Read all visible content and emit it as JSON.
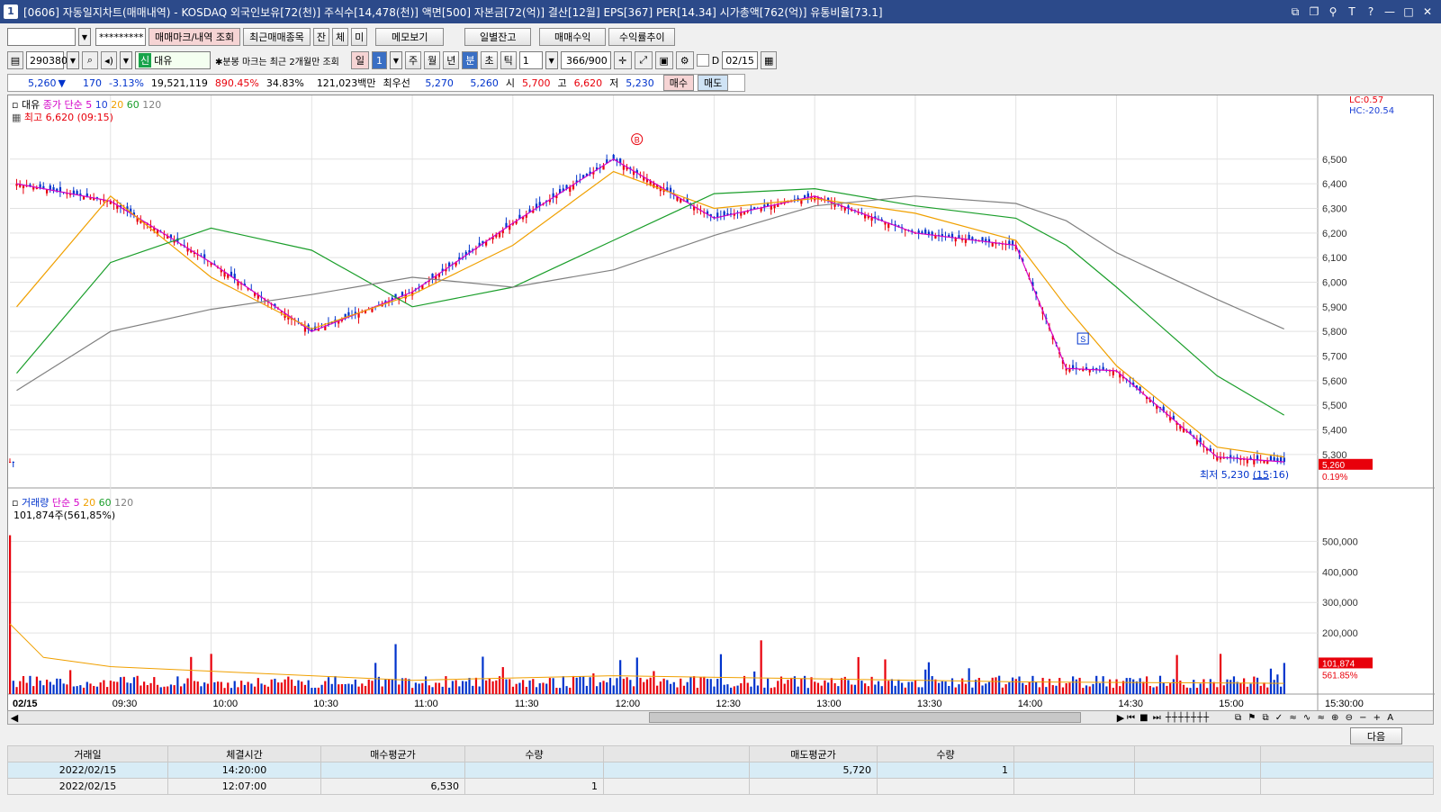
{
  "window": {
    "number": "1",
    "title": "[0606] 자동일지차트(매매내역) - KOSDAQ 외국인보유[72(천)] 주식수[14,478(천)] 액면[500] 자본금[72(억)] 결산[12월] EPS[367] PER[14.34] 시가총액[762(억)] 유통비율[73.1]"
  },
  "toolbar1": {
    "account_value": "",
    "password_mask": "*********",
    "btn_marks": "매매마크/내역 조회",
    "btn_recent": "최근매매종목",
    "btn_jan": "잔",
    "btn_che": "체",
    "btn_mi": "미",
    "btn_memo": "메모보기",
    "btn_daily": "일별잔고",
    "btn_profit": "매매수익",
    "btn_trend": "수익률추이"
  },
  "toolbar2": {
    "code": "290380",
    "badge": "신",
    "name": "대유",
    "note": "✱분봉 마크는 최근 2개월만 조회",
    "period_il": "일",
    "period_num": "1",
    "ju": "주",
    "wol": "월",
    "nyeon": "년",
    "bun": "분",
    "cho": "초",
    "tik": "틱",
    "interval": "1",
    "count": "366/900",
    "d_label": "D",
    "date": "02/15"
  },
  "quote": {
    "price": "5,260",
    "arrow": "▼",
    "change": "170",
    "pct": "-3.13%",
    "volume": "19,521,119",
    "vol_ratio": "890.45%",
    "turnover": "34.83%",
    "amount": "121,023백만",
    "best_label": "최우선",
    "best_ask": "5,270",
    "best_bid": "5,260",
    "open_label": "시",
    "open": "5,700",
    "high_label": "고",
    "high": "6,620",
    "low_label": "저",
    "low": "5,230",
    "buy": "매수",
    "sell": "매도"
  },
  "price_panel": {
    "name": "대유",
    "legend_prefix": "종가 단순",
    "ma_periods": [
      "5",
      "10",
      "20",
      "60",
      "120"
    ],
    "high_note": "최고 6,620 (09:15)",
    "low_note": "최저 5,230 (15:16)",
    "lc": "LC:0.57",
    "hc": "HC:-20.54",
    "current_tag": "5,260",
    "current_pct": "0.19%",
    "y_ticks": [
      "6,500",
      "6,400",
      "6,300",
      "6,200",
      "6,100",
      "6,000",
      "5,900",
      "5,800",
      "5,700",
      "5,600",
      "5,500",
      "5,400",
      "5,300"
    ],
    "marker_buy": "B",
    "marker_sell": "S"
  },
  "volume_panel": {
    "name": "거래량",
    "legend_prefix": "단순",
    "ma_periods": [
      "5",
      "20",
      "60",
      "120"
    ],
    "note": "101,874주(561,85%)",
    "y_ticks": [
      "500,000",
      "400,000",
      "300,000",
      "200,000"
    ],
    "current_tag": "101,874",
    "current_pct": "561.85%"
  },
  "x_axis": {
    "labels": [
      "02/15",
      "09:30",
      "10:00",
      "10:30",
      "11:00",
      "11:30",
      "12:00",
      "12:30",
      "13:00",
      "13:30",
      "14:00",
      "14:30",
      "15:00",
      "15:30:00"
    ]
  },
  "colors": {
    "up": "#e8000b",
    "down": "#0033cc",
    "ma5": "#d400c8",
    "ma10": "#1a3fd6",
    "ma20": "#f0a000",
    "ma60": "#1a9e2a",
    "ma120": "#808080"
  },
  "chart_data": {
    "type": "candlestick",
    "title": "대유",
    "xlabel": "",
    "ylabel": "",
    "ylim": [
      5200,
      6620
    ],
    "ma_series": [
      {
        "name": "5",
        "x": [
          "09:02",
          "09:30",
          "10:00",
          "10:30",
          "11:00",
          "11:30",
          "12:00",
          "12:30",
          "13:00",
          "13:30",
          "14:00",
          "14:15",
          "14:30",
          "15:00",
          "15:20"
        ],
        "values": [
          6400,
          6330,
          6080,
          5800,
          5960,
          6240,
          6500,
          6260,
          6350,
          6200,
          6150,
          5650,
          5640,
          5290,
          5270
        ]
      },
      {
        "name": "20",
        "x": [
          "09:02",
          "09:30",
          "10:00",
          "10:30",
          "11:00",
          "11:30",
          "12:00",
          "12:30",
          "13:00",
          "13:30",
          "14:00",
          "14:15",
          "14:30",
          "15:00",
          "15:20"
        ],
        "values": [
          5900,
          6350,
          6020,
          5810,
          5950,
          6150,
          6450,
          6300,
          6340,
          6280,
          6170,
          5900,
          5660,
          5330,
          5290
        ]
      },
      {
        "name": "60",
        "x": [
          "09:02",
          "09:30",
          "10:00",
          "10:30",
          "11:00",
          "11:30",
          "12:00",
          "12:30",
          "13:00",
          "13:30",
          "14:00",
          "14:15",
          "14:30",
          "15:00",
          "15:20"
        ],
        "values": [
          5630,
          6080,
          6220,
          6130,
          5900,
          5980,
          6170,
          6360,
          6380,
          6310,
          6260,
          6150,
          5980,
          5620,
          5460
        ]
      },
      {
        "name": "120",
        "x": [
          "09:02",
          "09:30",
          "10:00",
          "10:30",
          "11:00",
          "11:30",
          "12:00",
          "12:30",
          "13:00",
          "13:30",
          "14:00",
          "14:15",
          "14:30",
          "15:00",
          "15:20"
        ],
        "values": [
          5560,
          5800,
          5890,
          5950,
          6020,
          5980,
          6050,
          6190,
          6310,
          6350,
          6320,
          6250,
          6120,
          5930,
          5810
        ]
      }
    ],
    "price_summary": {
      "open": 5700,
      "high": 6620,
      "low": 5230,
      "close": 5260
    },
    "volume": {
      "max_bar": 520000,
      "last": 101874
    }
  },
  "hscroll": {
    "left": "◀",
    "right": "▶"
  },
  "table": {
    "next_btn": "다음",
    "headers": [
      "거래일",
      "체결시간",
      "매수평균가",
      "수량",
      "",
      "매도평균가",
      "수량",
      "",
      "",
      ""
    ],
    "rows": [
      {
        "date": "2022/02/15",
        "time": "14:20:00",
        "buy_avg": "",
        "buy_qty": "",
        "sell_avg": "5,720",
        "sell_qty": "1"
      },
      {
        "date": "2022/02/15",
        "time": "12:07:00",
        "buy_avg": "6,530",
        "buy_qty": "1",
        "sell_avg": "",
        "sell_qty": ""
      }
    ]
  }
}
